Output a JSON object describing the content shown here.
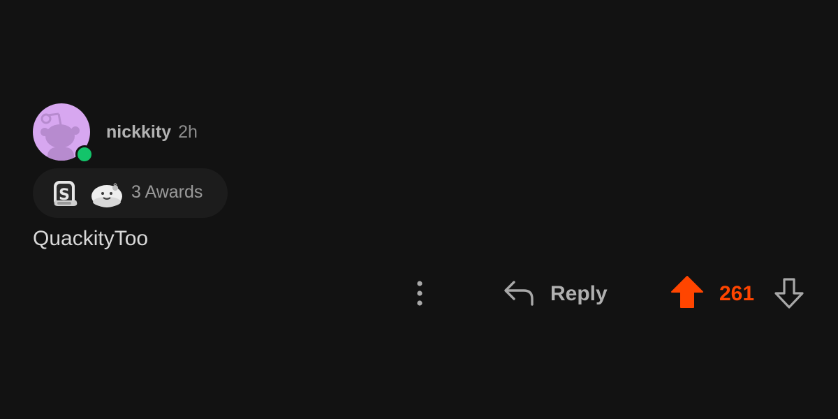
{
  "comment": {
    "author": "nickkity",
    "age": "2h",
    "author_online": true,
    "avatar_icon": "snoo-avatar-icon",
    "online_indicator_color": "#13c46a",
    "awards": {
      "icons": [
        "silver-award-icon",
        "wholesome-seal-award-icon"
      ],
      "label": "3 Awards"
    },
    "body": "QuackityToo"
  },
  "actions": {
    "more_icon": "more-vertical-icon",
    "reply_icon": "reply-arrow-icon",
    "reply_label": "Reply",
    "upvote_icon": "upvote-arrow-icon",
    "upvoted": true,
    "score": "261",
    "downvote_icon": "downvote-arrow-icon"
  },
  "colors": {
    "background": "#121212",
    "upvote_accent": "#ff4500",
    "avatar_background": "#d7a7f0"
  }
}
